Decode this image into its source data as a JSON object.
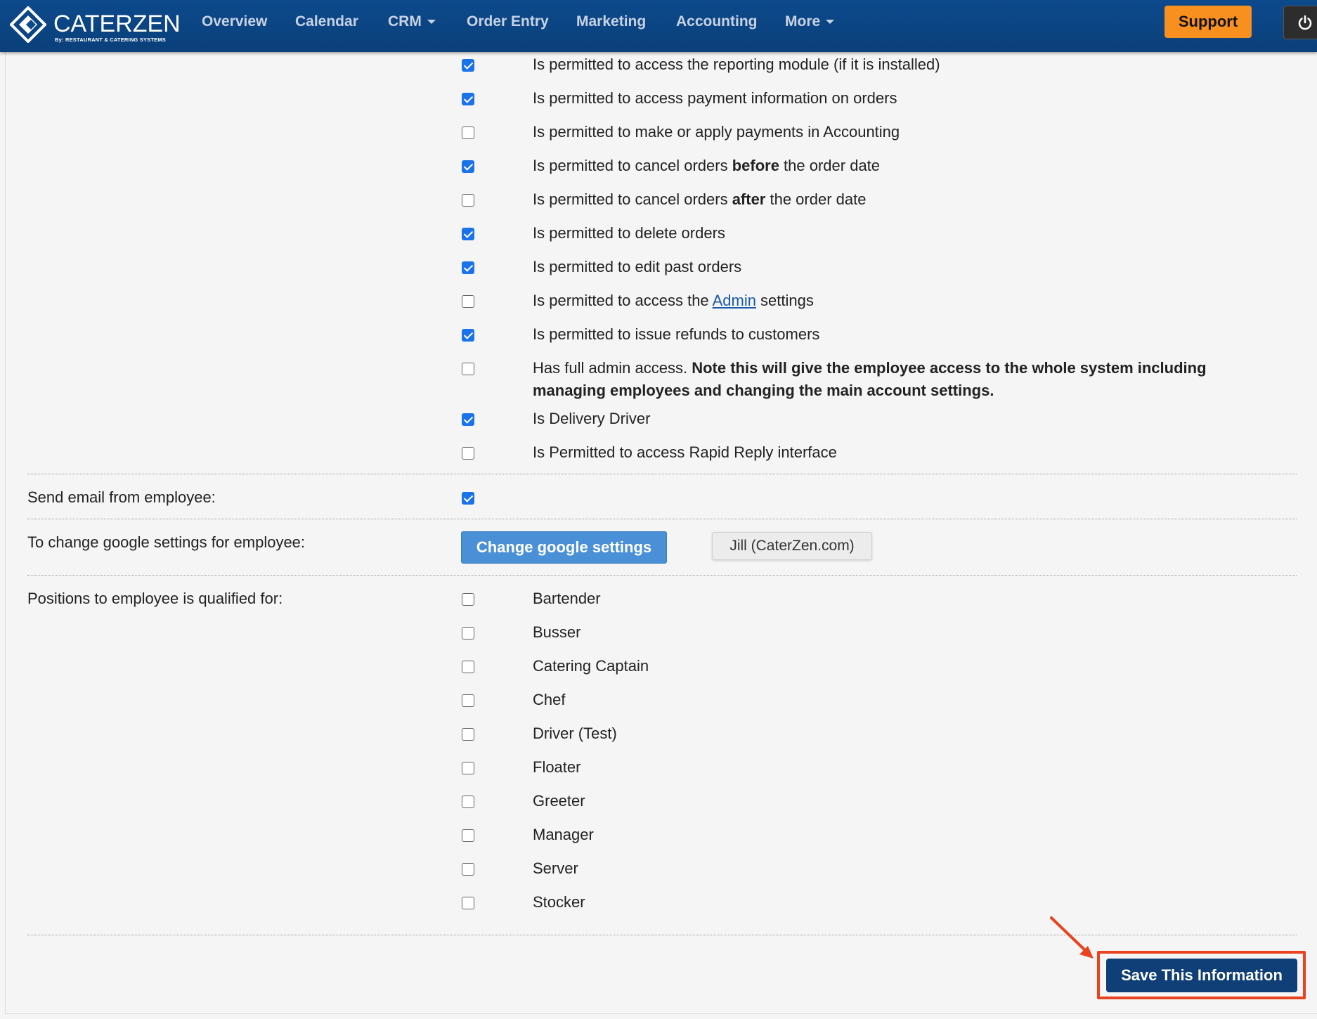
{
  "brand": {
    "name": "CATERZEN",
    "tagline": "By: RESTAURANT & CATERING SYSTEMS"
  },
  "nav": {
    "items": [
      {
        "label": "Overview"
      },
      {
        "label": "Calendar"
      },
      {
        "label": "CRM",
        "dropdown": true
      },
      {
        "label": "Order Entry"
      },
      {
        "label": "Marketing"
      },
      {
        "label": "Accounting"
      },
      {
        "label": "More",
        "dropdown": true
      }
    ],
    "support_label": "Support",
    "power_icon": "power-icon"
  },
  "permissions": [
    {
      "checked": true,
      "pre": "Is permitted to access the reporting module (if it is installed)"
    },
    {
      "checked": true,
      "pre": "Is permitted to access payment information on orders"
    },
    {
      "checked": false,
      "pre": "Is permitted to make or apply payments in Accounting"
    },
    {
      "checked": true,
      "pre": "Is permitted to cancel orders ",
      "bold": "before",
      "post": " the order date"
    },
    {
      "checked": false,
      "pre": "Is permitted to cancel orders ",
      "bold": "after",
      "post": " the order date"
    },
    {
      "checked": true,
      "pre": "Is permitted to delete orders"
    },
    {
      "checked": true,
      "pre": "Is permitted to edit past orders"
    },
    {
      "checked": false,
      "pre": "Is permitted to access the ",
      "link": "Admin",
      "post": " settings"
    },
    {
      "checked": true,
      "pre": "Is permitted to issue refunds to customers"
    },
    {
      "checked": false,
      "pre": "Has full admin access. ",
      "bold": "Note this will give the employee access to the whole system including",
      "line2_bold": "managing employees and changing the main account settings."
    },
    {
      "checked": true,
      "pre": "Is Delivery Driver"
    },
    {
      "checked": false,
      "pre": "Is Permitted to access Rapid Reply interface"
    }
  ],
  "send_email": {
    "label": "Send email from employee:",
    "checked": true
  },
  "google": {
    "label": "To change google settings for employee:",
    "button_label": "Change google settings",
    "account": "Jill (CaterZen.com)"
  },
  "positions": {
    "label": "Positions to employee is qualified for:",
    "items": [
      {
        "name": "Bartender",
        "checked": false
      },
      {
        "name": "Busser",
        "checked": false
      },
      {
        "name": "Catering Captain",
        "checked": false
      },
      {
        "name": "Chef",
        "checked": false
      },
      {
        "name": "Driver (Test)",
        "checked": false
      },
      {
        "name": "Floater",
        "checked": false
      },
      {
        "name": "Greeter",
        "checked": false
      },
      {
        "name": "Manager",
        "checked": false
      },
      {
        "name": "Server",
        "checked": false
      },
      {
        "name": "Stocker",
        "checked": false
      }
    ]
  },
  "save": {
    "label": "Save This Information",
    "highlight_color": "#e8431e"
  },
  "colors": {
    "nav_bg": "#0d4a8c",
    "support": "#f7901e",
    "checkbox": "#1a73e8",
    "google_btn": "#4a90d6",
    "save_btn": "#0f3f76"
  }
}
